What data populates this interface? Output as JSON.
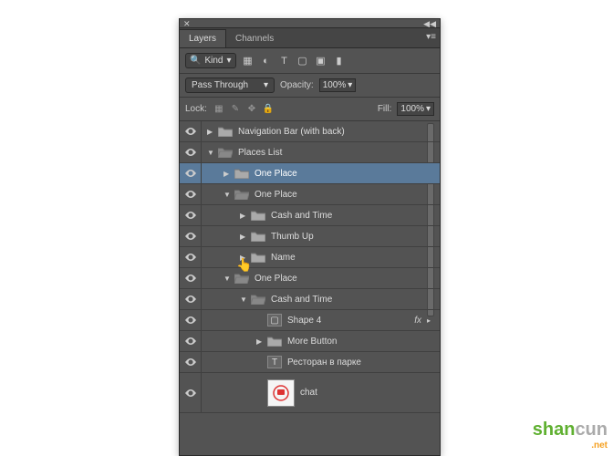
{
  "tabs": {
    "layers": "Layers",
    "channels": "Channels"
  },
  "filter": {
    "kind": "Kind"
  },
  "blend": {
    "mode": "Pass Through",
    "opacity_label": "Opacity:",
    "opacity_value": "100%"
  },
  "lock": {
    "label": "Lock:",
    "fill_label": "Fill:",
    "fill_value": "100%"
  },
  "layers": [
    {
      "name": "Navigation Bar (with back)",
      "indent": 0,
      "expanded": false,
      "icon": "folder"
    },
    {
      "name": "Places List",
      "indent": 0,
      "expanded": true,
      "icon": "folder-open"
    },
    {
      "name": "One Place",
      "indent": 1,
      "expanded": false,
      "icon": "folder",
      "selected": true
    },
    {
      "name": "One Place",
      "indent": 1,
      "expanded": true,
      "icon": "folder-open"
    },
    {
      "name": "Cash and Time",
      "indent": 2,
      "expanded": false,
      "icon": "folder"
    },
    {
      "name": "Thumb Up",
      "indent": 2,
      "expanded": false,
      "icon": "folder"
    },
    {
      "name": "Name",
      "indent": 2,
      "expanded": false,
      "icon": "folder"
    },
    {
      "name": "One Place",
      "indent": 1,
      "expanded": true,
      "icon": "folder-open"
    },
    {
      "name": "Cash and Time",
      "indent": 2,
      "expanded": true,
      "icon": "folder-open"
    },
    {
      "name": "Shape 4",
      "indent": 3,
      "icon": "shape",
      "fx": "fx"
    },
    {
      "name": "More Button",
      "indent": 3,
      "expanded": false,
      "icon": "folder"
    },
    {
      "name": "Ресторан в парке",
      "indent": 3,
      "icon": "text"
    },
    {
      "name": "chat",
      "indent": 3,
      "icon": "thumb"
    }
  ],
  "watermark": {
    "part1": "shan",
    "part2": "cun",
    "sub": ".net"
  }
}
